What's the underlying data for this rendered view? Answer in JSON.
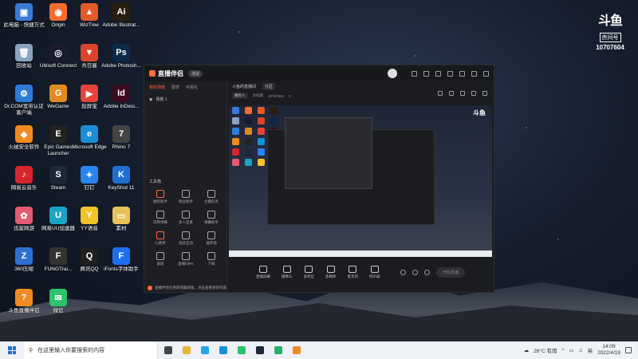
{
  "desktop": {
    "icons": [
      {
        "label": "此电脑 - 快捷方式",
        "color": "#3a7bd5",
        "glyph": "▣"
      },
      {
        "label": "Origin",
        "color": "#f56c2d",
        "glyph": "◉"
      },
      {
        "label": "WizTree",
        "color": "#e05a2a",
        "glyph": "▲"
      },
      {
        "label": "Adobe Illustrat...",
        "color": "#2b1d0e",
        "glyph": "Ai"
      },
      {
        "label": "回收站",
        "color": "#8aa3c0",
        "glyph": "🗑"
      },
      {
        "label": "Ubisoft Connect",
        "color": "#1b1b2e",
        "glyph": "◎"
      },
      {
        "label": "共日暴",
        "color": "#d9442b",
        "glyph": "▼"
      },
      {
        "label": "Adobe Photosh...",
        "color": "#0c2a4a",
        "glyph": "Ps"
      },
      {
        "label": "Dr.COM宽带认证客户端",
        "color": "#2e7bd8",
        "glyph": "⚙"
      },
      {
        "label": "WeGame",
        "color": "#e08a22",
        "glyph": "G"
      },
      {
        "label": "投屏宝",
        "color": "#e6433b",
        "glyph": "▶"
      },
      {
        "label": "Adobe InDesi...",
        "color": "#3a0b21",
        "glyph": "Id"
      },
      {
        "label": "火绒安全软件",
        "color": "#f08b1f",
        "glyph": "◆"
      },
      {
        "label": "Epic Games Launcher",
        "color": "#222",
        "glyph": "E"
      },
      {
        "label": "Microsoft Edge",
        "color": "#1a8fd6",
        "glyph": "e"
      },
      {
        "label": "Rhino 7",
        "color": "#444",
        "glyph": "7"
      },
      {
        "label": "网易云音乐",
        "color": "#d6262d",
        "glyph": "♪"
      },
      {
        "label": "Steam",
        "color": "#1b2838",
        "glyph": "S"
      },
      {
        "label": "钉钉",
        "color": "#2a85f1",
        "glyph": "✦"
      },
      {
        "label": "KeyShot 11",
        "color": "#1f6fd1",
        "glyph": "K"
      },
      {
        "label": "迅雷网游",
        "color": "#e35b72",
        "glyph": "✿"
      },
      {
        "label": "网易UU加速器",
        "color": "#1aa3c6",
        "glyph": "U"
      },
      {
        "label": "YY语音",
        "color": "#f2c32a",
        "glyph": "Y"
      },
      {
        "label": "素材",
        "color": "#e8c35a",
        "glyph": "▭"
      },
      {
        "label": "360压缩",
        "color": "#2d6fd0",
        "glyph": "Z"
      },
      {
        "label": "FUNGTrai...",
        "color": "#333",
        "glyph": "F"
      },
      {
        "label": "腾讯QQ",
        "color": "#1f1f1f",
        "glyph": "Q"
      },
      {
        "label": "iFonts字体助手",
        "color": "#1e6ff0",
        "glyph": "F"
      },
      {
        "label": "斗鱼直播伴侣",
        "color": "#f08a24",
        "glyph": "?"
      },
      {
        "label": "微信",
        "color": "#2dc26b",
        "glyph": "✉"
      }
    ]
  },
  "watermark": {
    "logo": "斗鱼",
    "room_label": "房间号",
    "room_number": "10707604"
  },
  "app": {
    "title": "直播伴侣",
    "version": "测试",
    "left_tabs": [
      "我的场景",
      "图表",
      "可视化"
    ],
    "scene_name": "场景 1",
    "toolbox_label": "工具箱",
    "tools": [
      "抽奖助手",
      "粉丝助手",
      "主播任务",
      "玩转弹幕",
      "多人连麦",
      "弹幕助手",
      "心愿单",
      "道具互动",
      "抽奖墙",
      "录屏",
      "直播间PK",
      "下载"
    ],
    "main_tabs": [
      "斗鱼的直播间",
      "分区"
    ],
    "info_tag": "睡觉人",
    "info_label": "没标题",
    "room_id": "10707604",
    "viewers": "0",
    "controls": [
      "直播屏幕",
      "摄像头",
      "多机位",
      "多媒体",
      "麦克风",
      "扬声器"
    ],
    "start_button": "开始直播",
    "notice": "直播伴侣已更新到最新版，点击查看更新内容",
    "preview_logo": "斗鱼"
  },
  "taskbar": {
    "search_placeholder": "在这里输入你要搜索的内容",
    "weather": "26°C 有雨",
    "lang": "英",
    "time": "14:09",
    "date": "2022/4/18",
    "apps": [
      {
        "name": "task-view",
        "color": "#444"
      },
      {
        "name": "file-explorer",
        "color": "#e8b339"
      },
      {
        "name": "store",
        "color": "#2aa3e8"
      },
      {
        "name": "edge",
        "color": "#1a8fd6"
      },
      {
        "name": "wechat",
        "color": "#2dc26b"
      },
      {
        "name": "steam",
        "color": "#1b2838"
      },
      {
        "name": "app-green",
        "color": "#23b26b"
      },
      {
        "name": "douyu",
        "color": "#f08a24"
      }
    ]
  }
}
